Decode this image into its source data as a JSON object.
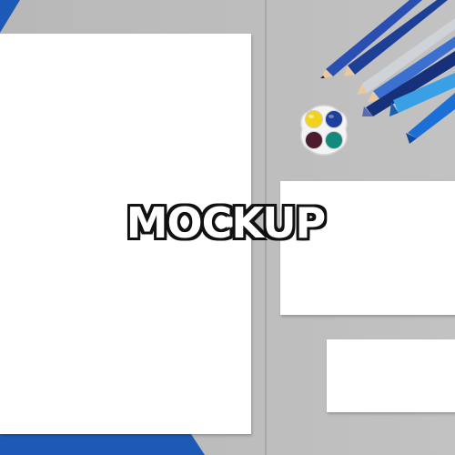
{
  "watermark": {
    "text": "MOCKUP"
  },
  "palette": {
    "wells": [
      "#f2d21a",
      "#1f3f9c",
      "#4a1c2e",
      "#138a7a"
    ]
  },
  "colors": {
    "surface": "#bdbdbd",
    "paper": "#ffffff",
    "blue_sheet": "#1d5ab8"
  },
  "objects": [
    "paper-a4-icon",
    "paper-card-icon",
    "paper-slip-icon",
    "paint-palette-icon",
    "colored-pencils-icon",
    "marker-pens-icon"
  ]
}
